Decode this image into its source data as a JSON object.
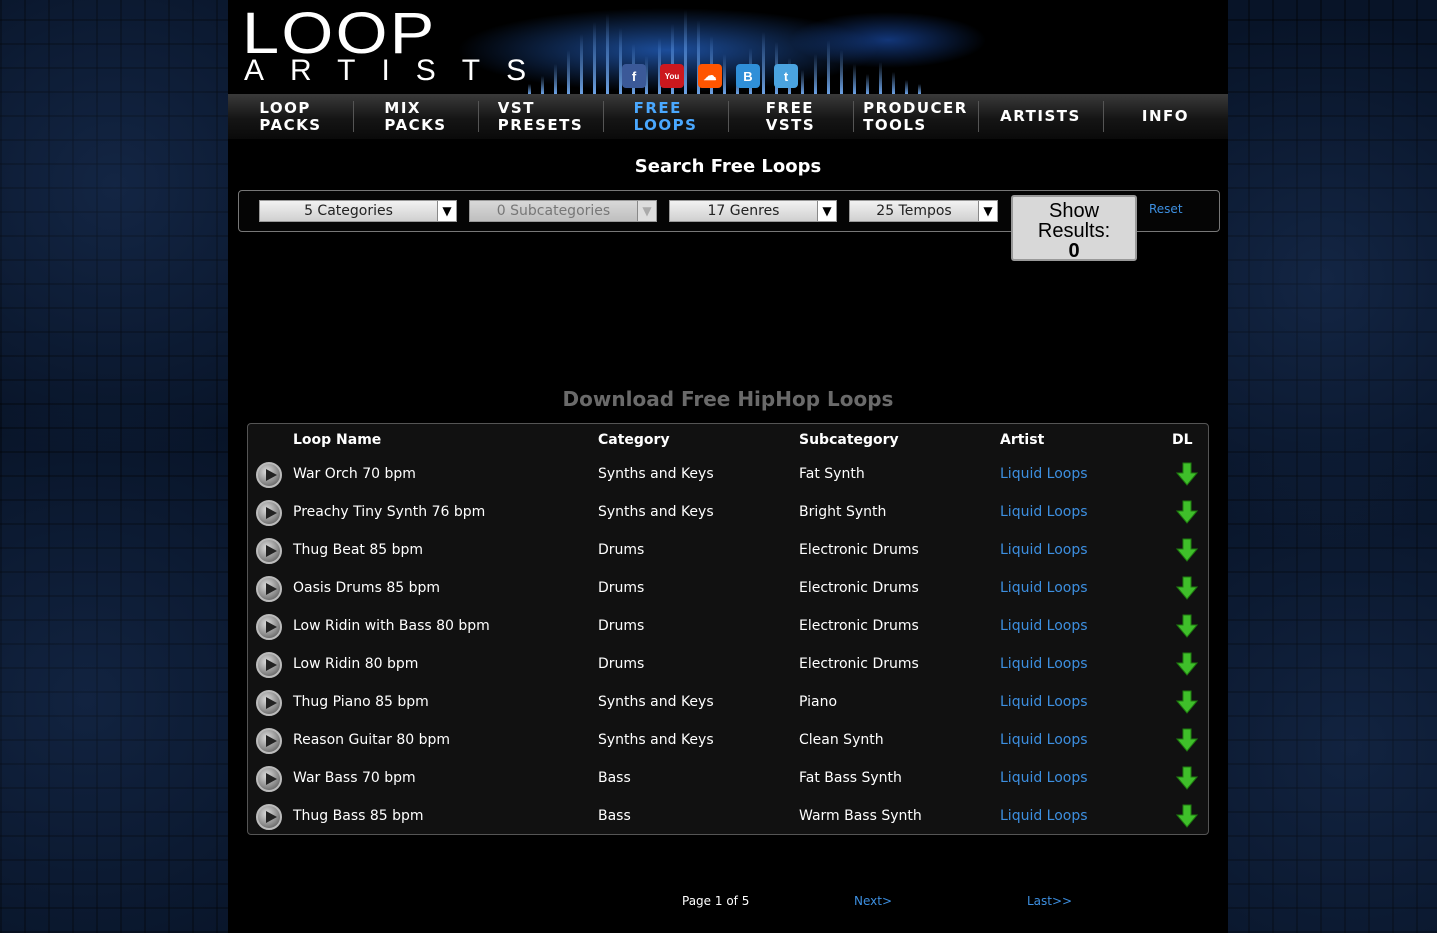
{
  "logo": {
    "top": "LOOP",
    "bottom": "ARTISTS"
  },
  "social": [
    {
      "icon": "facebook-icon",
      "glyph": "f",
      "color": "#3b5998"
    },
    {
      "icon": "youtube-icon",
      "glyph": "You",
      "color": "#cc181e"
    },
    {
      "icon": "soundcloud-icon",
      "glyph": "☁",
      "color": "#ff5500"
    },
    {
      "icon": "blogger-icon",
      "glyph": "B",
      "color": "#2f8fd8"
    },
    {
      "icon": "twitter-icon",
      "glyph": "t",
      "color": "#4aa3df"
    }
  ],
  "nav": [
    {
      "label": "LOOP\nPACKS"
    },
    {
      "label": "MIX\nPACKS"
    },
    {
      "label": "VST\nPRESETS"
    },
    {
      "label": "FREE\nLOOPS",
      "active": true
    },
    {
      "label": "FREE\nVSTS"
    },
    {
      "label": "PRODUCER\nTOOLS"
    },
    {
      "label": "ARTISTS"
    },
    {
      "label": "INFO"
    }
  ],
  "search": {
    "title": "Search Free Loops",
    "categories": "5 Categories",
    "subcategories": "0 Subcategories",
    "genres": "17 Genres",
    "tempos": "25 Tempos",
    "show_results_label": "Show Results:",
    "show_results_count": "0",
    "reset": "Reset"
  },
  "results": {
    "title": "Download Free HipHop Loops",
    "columns": {
      "name": "Loop Name",
      "category": "Category",
      "subcategory": "Subcategory",
      "artist": "Artist",
      "dl": "DL"
    },
    "rows": [
      {
        "name": "War Orch 70 bpm",
        "category": "Synths and Keys",
        "subcategory": "Fat Synth",
        "artist": "Liquid Loops"
      },
      {
        "name": "Preachy Tiny Synth 76 bpm",
        "category": "Synths and Keys",
        "subcategory": "Bright Synth",
        "artist": "Liquid Loops"
      },
      {
        "name": "Thug Beat 85 bpm",
        "category": "Drums",
        "subcategory": "Electronic Drums",
        "artist": "Liquid Loops"
      },
      {
        "name": "Oasis Drums 85 bpm",
        "category": "Drums",
        "subcategory": "Electronic Drums",
        "artist": "Liquid Loops"
      },
      {
        "name": "Low Ridin with Bass 80 bpm",
        "category": "Drums",
        "subcategory": "Electronic Drums",
        "artist": "Liquid Loops"
      },
      {
        "name": "Low Ridin 80 bpm",
        "category": "Drums",
        "subcategory": "Electronic Drums",
        "artist": "Liquid Loops"
      },
      {
        "name": "Thug Piano 85 bpm",
        "category": "Synths and Keys",
        "subcategory": "Piano",
        "artist": "Liquid Loops"
      },
      {
        "name": "Reason Guitar 80 bpm",
        "category": "Synths and Keys",
        "subcategory": "Clean Synth",
        "artist": "Liquid Loops"
      },
      {
        "name": "War Bass 70 bpm",
        "category": "Bass",
        "subcategory": "Fat Bass Synth",
        "artist": "Liquid Loops"
      },
      {
        "name": "Thug Bass 85 bpm",
        "category": "Bass",
        "subcategory": "Warm Bass Synth",
        "artist": "Liquid Loops"
      }
    ]
  },
  "pager": {
    "info": "Page 1 of 5",
    "next": "Next>",
    "last": "Last>>"
  }
}
